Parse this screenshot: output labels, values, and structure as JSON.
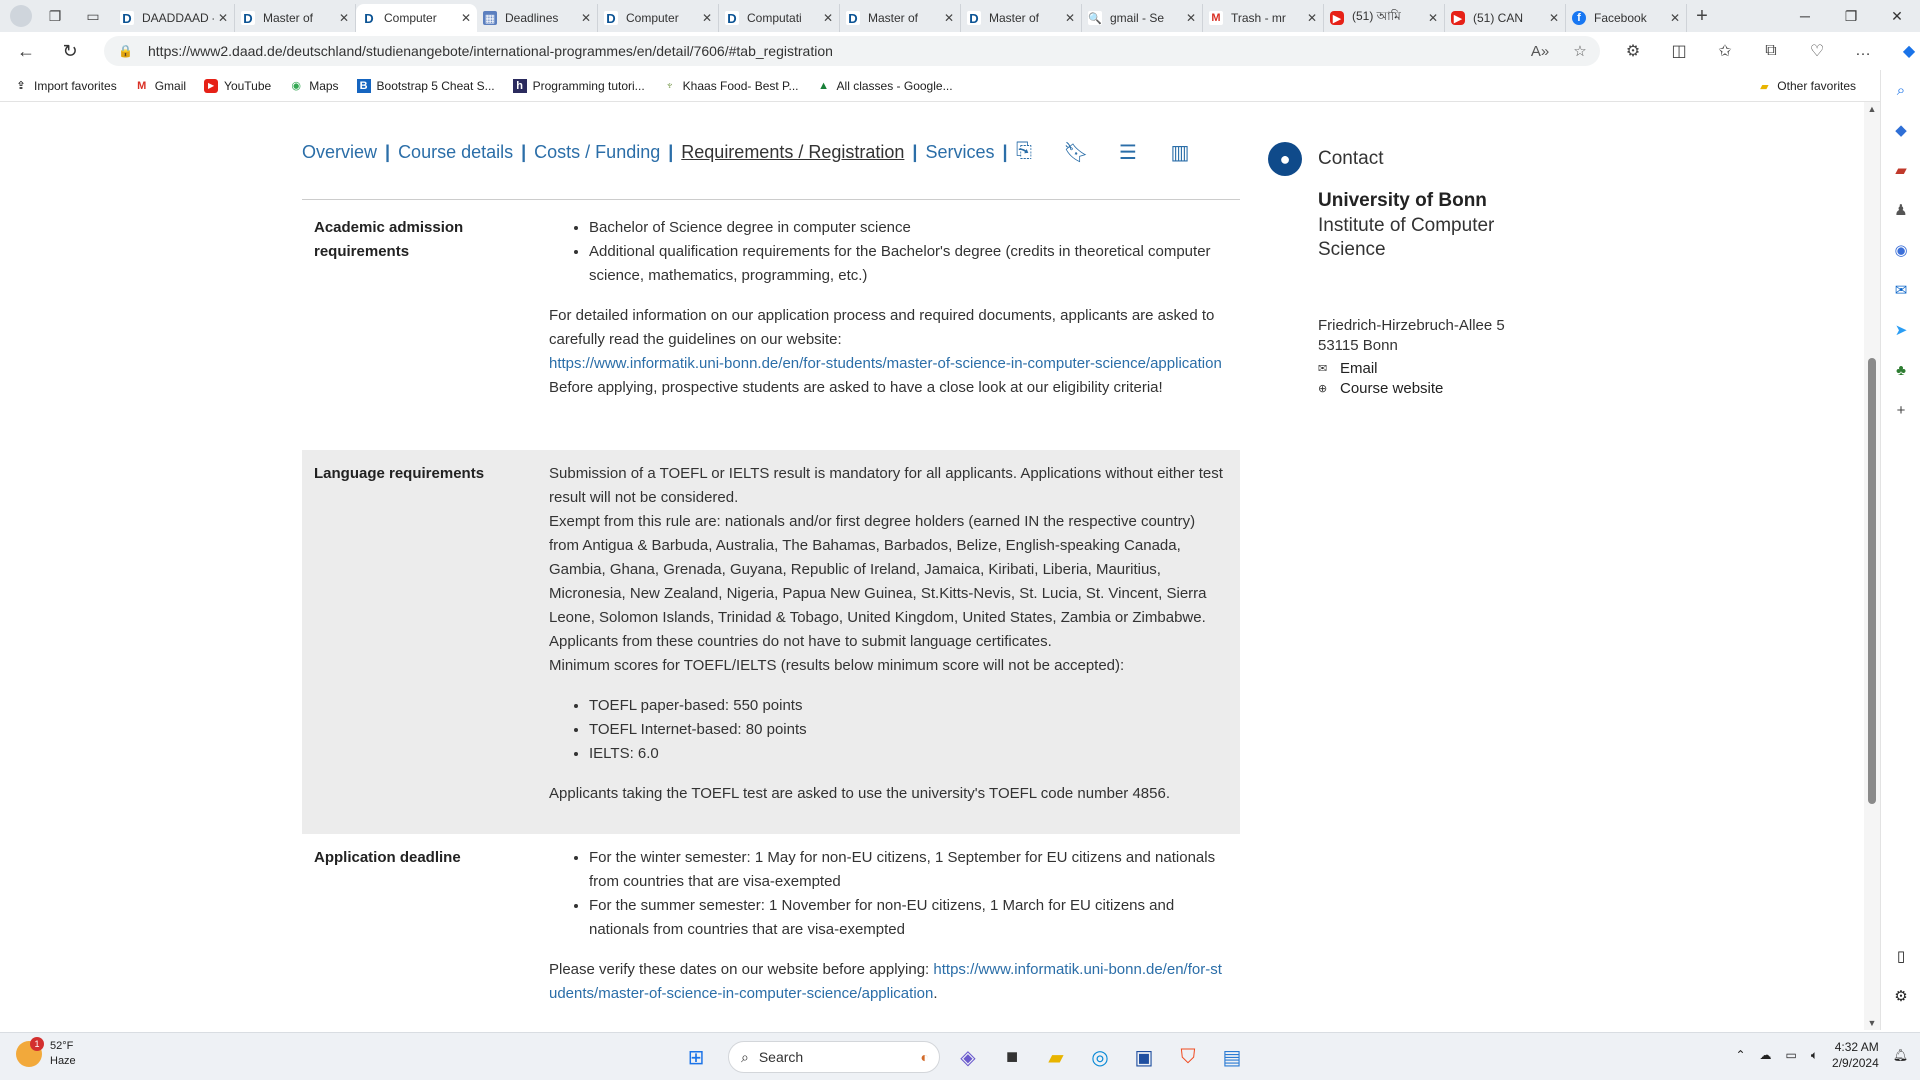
{
  "browser": {
    "tabs": [
      {
        "icon": "D",
        "label": "DAADDAAD - Int",
        "close": "✕"
      },
      {
        "icon": "D",
        "label": "Master of",
        "close": "✕"
      },
      {
        "icon": "D",
        "label": "Computer",
        "close": "✕"
      },
      {
        "icon": "▦",
        "label": "Deadlines",
        "close": "✕"
      },
      {
        "icon": "D",
        "label": "Computer",
        "close": "✕"
      },
      {
        "icon": "D",
        "label": "Computati",
        "close": "✕"
      },
      {
        "icon": "D",
        "label": "Master of",
        "close": "✕"
      },
      {
        "icon": "D",
        "label": "Master of",
        "close": "✕"
      },
      {
        "icon": "🔍",
        "label": "gmail - Se",
        "close": "✕"
      },
      {
        "icon": "M",
        "label": "Trash - mr",
        "close": "✕"
      },
      {
        "icon": "▶",
        "label": "(51) আমি",
        "close": "✕"
      },
      {
        "icon": "▶",
        "label": "(51) CAN",
        "close": "✕"
      },
      {
        "icon": "f",
        "label": "Facebook",
        "close": "✕"
      }
    ],
    "new_tab": "+",
    "url": "https://www2.daad.de/deutschland/studienangebote/international-programmes/en/detail/7606/#tab_registration"
  },
  "favorites": [
    {
      "label": "Import favorites"
    },
    {
      "label": "Gmail"
    },
    {
      "label": "YouTube"
    },
    {
      "label": "Maps"
    },
    {
      "label": "Bootstrap 5 Cheat S..."
    },
    {
      "label": "Programming tutori..."
    },
    {
      "label": "Khaas Food- Best P..."
    },
    {
      "label": "All classes - Google..."
    }
  ],
  "other_favorites": "Other favorites",
  "page_nav": {
    "items": [
      "Overview",
      "Course details",
      "Costs / Funding",
      "Requirements / Registration",
      "Services"
    ]
  },
  "academic": {
    "label": "Academic admission requirements",
    "bullets": [
      "Bachelor of Science degree in computer science",
      "Additional qualification requirements for the Bachelor's degree (credits in theoretical computer science, mathematics, programming, etc.)"
    ],
    "para1": "For detailed information on our application process and required documents, applicants are asked to carefully read the guidelines on our website:",
    "link": "https://www.informatik.uni-bonn.de/en/for-students/master-of-science-in-computer-science/application",
    "para2": "Before applying, prospective students are asked to have a close look at our eligibility criteria!"
  },
  "language": {
    "label": "Language requirements",
    "para1": "Submission of a TOEFL or IELTS result is mandatory for all applicants. Applications without either test result will not be considered.",
    "para2": "Exempt from this rule are: nationals and/or first degree holders (earned IN the respective country) from Antigua & Barbuda, Australia, The Bahamas, Barbados, Belize, English-speaking Canada, Gambia, Ghana, Grenada, Guyana, Republic of Ireland, Jamaica, Kiribati, Liberia, Mauritius, Micronesia, New Zealand, Nigeria, Papua New Guinea, St.Kitts-Nevis, St. Lucia, St. Vincent, Sierra Leone, Solomon Islands, Trinidad & Tobago, United Kingdom, United States, Zambia or Zimbabwe.",
    "para3": "Applicants from these countries do not have to submit language certificates.",
    "para4": "Minimum scores for TOEFL/IELTS (results below minimum score will not be accepted):",
    "bullets": [
      "TOEFL paper-based: 550 points",
      "TOEFL Internet-based: 80 points",
      "IELTS: 6.0"
    ],
    "para5": "Applicants taking the TOEFL test are asked to use the university's TOEFL code number 4856."
  },
  "deadline": {
    "label": "Application deadline",
    "bullets": [
      "For the winter semester: 1 May for non-EU citizens, 1 September for EU citizens and nationals from countries that are visa-exempted",
      "For the summer semester: 1 November for non-EU citizens, 1 March for EU citizens and nationals from countries that are visa-exempted"
    ],
    "para_prefix": "Please verify these dates on our website before applying: ",
    "link": "https://www.informatik.uni-bonn.de/en/for-students/master-of-science-in-computer-science/application",
    "para_suffix": "."
  },
  "contact": {
    "heading": "Contact",
    "university": "University of Bonn",
    "institute": "Institute of Computer Science",
    "street": "Friedrich-Hirzebruch-Allee 5",
    "city": "53115 Bonn",
    "email": "Email",
    "website": "Course website"
  },
  "taskbar": {
    "temp": "52°F",
    "condition": "Haze",
    "badge": "1",
    "search_placeholder": "Search",
    "time": "4:32 AM",
    "date": "2/9/2024"
  }
}
